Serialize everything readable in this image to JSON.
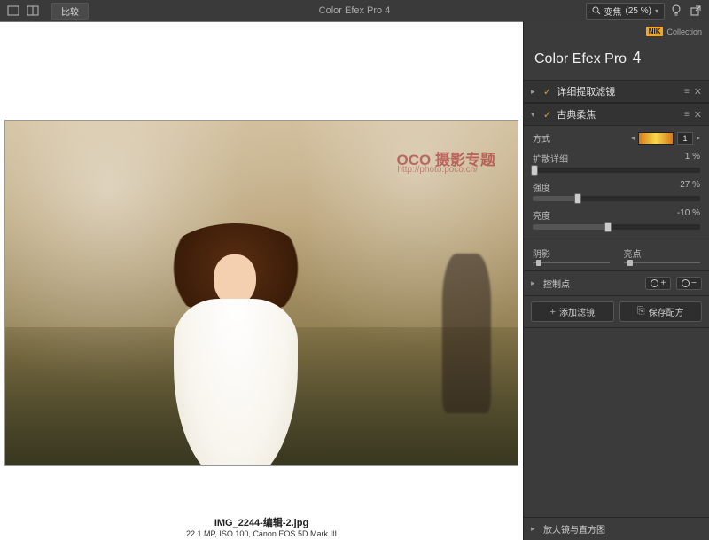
{
  "app": {
    "title": "Color Efex Pro 4",
    "panel_title": "Color Efex Pro",
    "panel_version": "4",
    "brand_badge": "NIK",
    "brand_text": "Collection"
  },
  "toolbar": {
    "compare_label": "比较",
    "zoom_label": "变焦",
    "zoom_value": "(25 %)"
  },
  "image": {
    "filename": "IMG_2244-编辑-2.jpg",
    "details": "22.1 MP, ISO 100, Canon EOS 5D Mark III",
    "watermark_line1": "OCO 摄影专题",
    "watermark_line2": "http://photo.poco.cn/"
  },
  "filters": [
    {
      "name": "详细提取滤镜",
      "open": false,
      "checked": true
    },
    {
      "name": "古典柔焦",
      "open": true,
      "checked": true
    }
  ],
  "controls": {
    "style_label": "方式",
    "style_index": "1",
    "sliders": [
      {
        "label": "扩散详细",
        "value_text": "1 %",
        "pos": 1
      },
      {
        "label": "强度",
        "value_text": "27 %",
        "pos": 27
      },
      {
        "label": "亮度",
        "value_text": "-10 %",
        "pos": 45
      }
    ],
    "shadow_label": "阴影",
    "highlight_label": "亮点",
    "control_points_label": "控制点",
    "add_filter_label": "添加滤镜",
    "save_recipe_label": "保存配方"
  },
  "bottom": {
    "loupe_label": "放大镜与直方图"
  },
  "icons": {
    "single": "single-view",
    "split": "split-view",
    "search": "search",
    "bulb": "bulb",
    "export": "export",
    "plus": "+",
    "minus": "−",
    "save": "⎘",
    "chevron": "▸",
    "chevron_down": "▾",
    "check": "✓",
    "menu": "≡",
    "close": "✕"
  }
}
